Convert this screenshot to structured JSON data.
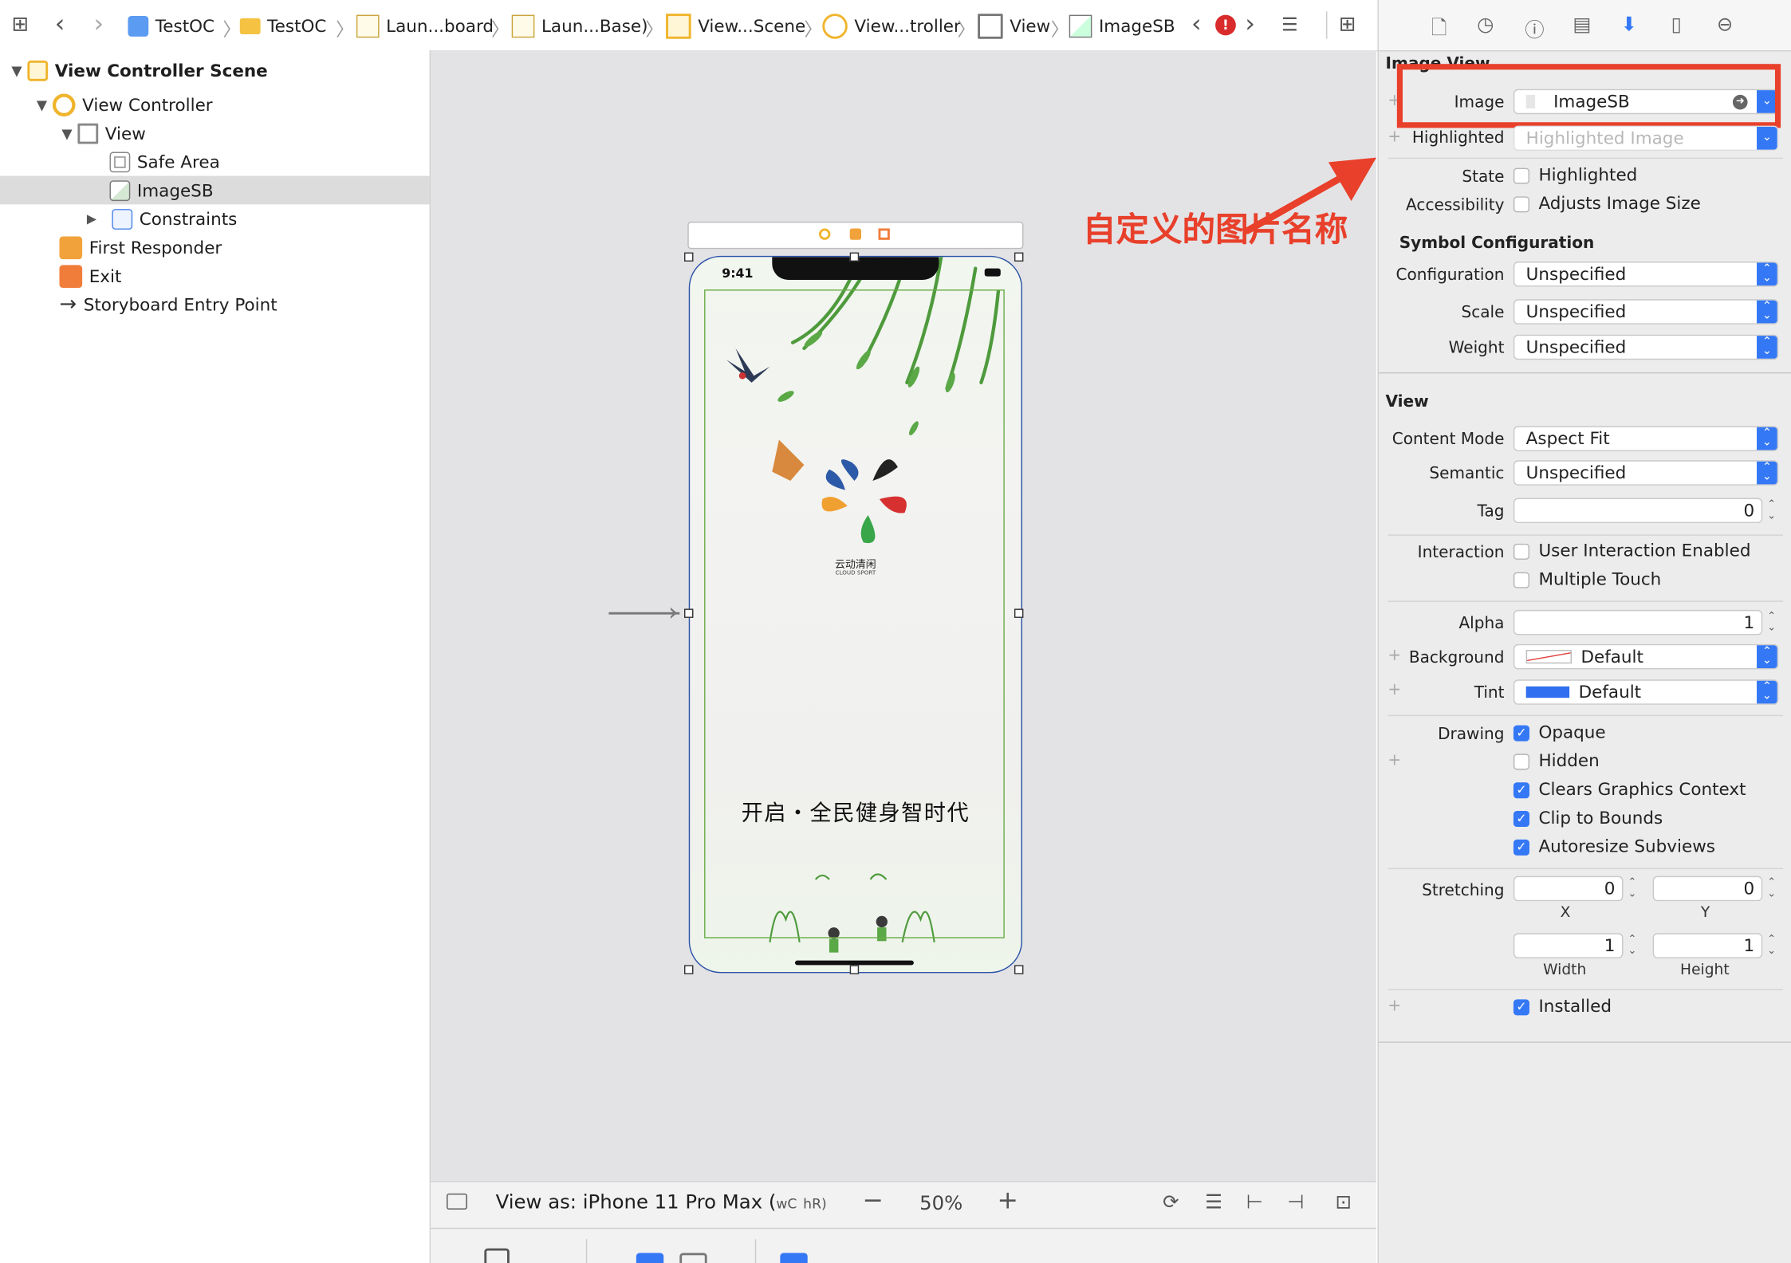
{
  "breadcrumbs": [
    "TestOC",
    "TestOC",
    "Laun...board",
    "Laun...Base)",
    "View...Scene",
    "View...troller",
    "View",
    "ImageSB"
  ],
  "navigator": {
    "items": [
      {
        "label": "View Controller Scene"
      },
      {
        "label": "View Controller"
      },
      {
        "label": "View"
      },
      {
        "label": "Safe Area"
      },
      {
        "label": "ImageSB"
      },
      {
        "label": "Constraints"
      },
      {
        "label": "First Responder"
      },
      {
        "label": "Exit"
      },
      {
        "label": "Storyboard Entry Point"
      }
    ]
  },
  "device": {
    "time": "9:41",
    "slogan": "开启・全民健身智时代",
    "logo_cn": "云动清闲",
    "logo_en": "CLOUD SPORT"
  },
  "bottom_bar": {
    "view_as": "View as: iPhone 11 Pro Max (",
    "wc": "wC",
    "hr": "hR)",
    "zoom": "50%"
  },
  "annotation": {
    "text": "自定义的图片名称",
    "color": "#e8402b"
  },
  "inspector": {
    "image_view": {
      "title": "Image View",
      "image_label": "Image",
      "image_value": "ImageSB",
      "highlighted_label": "Highlighted",
      "highlighted_placeholder": "Highlighted Image",
      "state_label": "State",
      "state_option": "Highlighted",
      "accessibility_label": "Accessibility",
      "accessibility_option": "Adjusts Image Size"
    },
    "symbol": {
      "title": "Symbol Configuration",
      "configuration_label": "Configuration",
      "configuration_value": "Unspecified",
      "scale_label": "Scale",
      "scale_value": "Unspecified",
      "weight_label": "Weight",
      "weight_value": "Unspecified"
    },
    "view": {
      "title": "View",
      "content_mode_label": "Content Mode",
      "content_mode_value": "Aspect Fit",
      "semantic_label": "Semantic",
      "semantic_value": "Unspecified",
      "tag_label": "Tag",
      "tag_value": "0",
      "interaction_label": "Interaction",
      "user_interaction": "User Interaction Enabled",
      "multiple_touch": "Multiple Touch",
      "alpha_label": "Alpha",
      "alpha_value": "1",
      "background_label": "Background",
      "background_value": "Default",
      "tint_label": "Tint",
      "tint_value": "Default",
      "tint_color": "#2f6ff0",
      "drawing_label": "Drawing",
      "opaque": "Opaque",
      "hidden": "Hidden",
      "clears": "Clears Graphics Context",
      "clip": "Clip to Bounds",
      "autoresize": "Autoresize Subviews",
      "stretching_label": "Stretching",
      "x_value": "0",
      "y_value": "0",
      "x_label": "X",
      "y_label": "Y",
      "width_value": "1",
      "height_value": "1",
      "width_label": "Width",
      "height_label": "Height",
      "installed": "Installed"
    }
  },
  "colors": {
    "accent": "#3478f6",
    "annotation": "#e8402b"
  }
}
